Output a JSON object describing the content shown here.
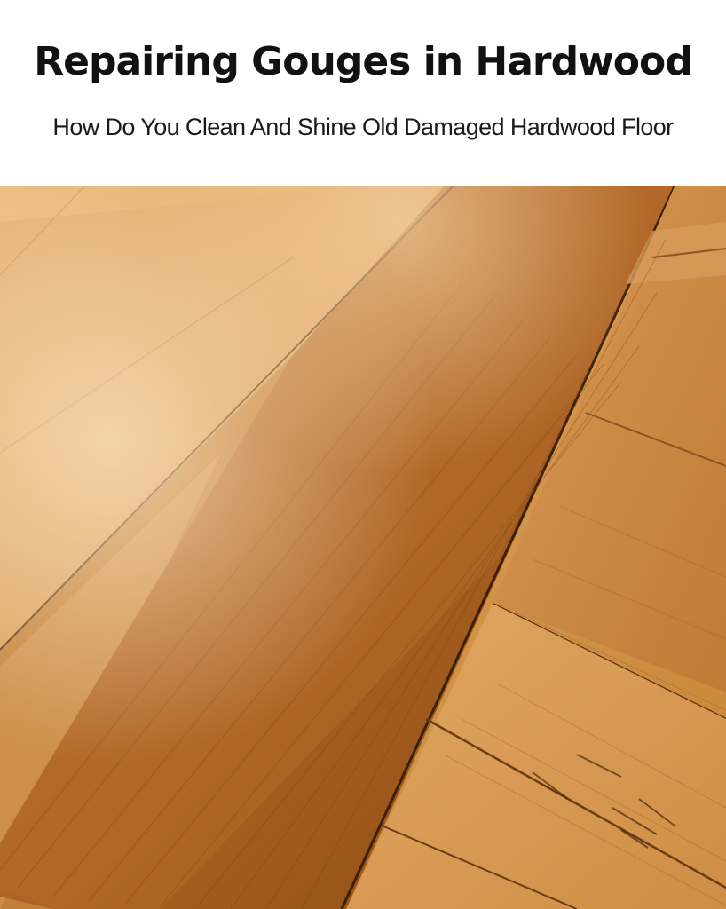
{
  "header": {
    "title": "Repairing Gouges in Hardwood",
    "subtitle": "How Do You Clean And Shine Old Damaged Hardwood Floor"
  },
  "photo": {
    "subject": "hardwood-floor",
    "colors": {
      "plank_light": "#d9a05a",
      "plank_mid": "#c17a32",
      "plank_dark": "#8f4e18",
      "seam": "#3a2008",
      "highlight": "#f5d3a0"
    }
  }
}
